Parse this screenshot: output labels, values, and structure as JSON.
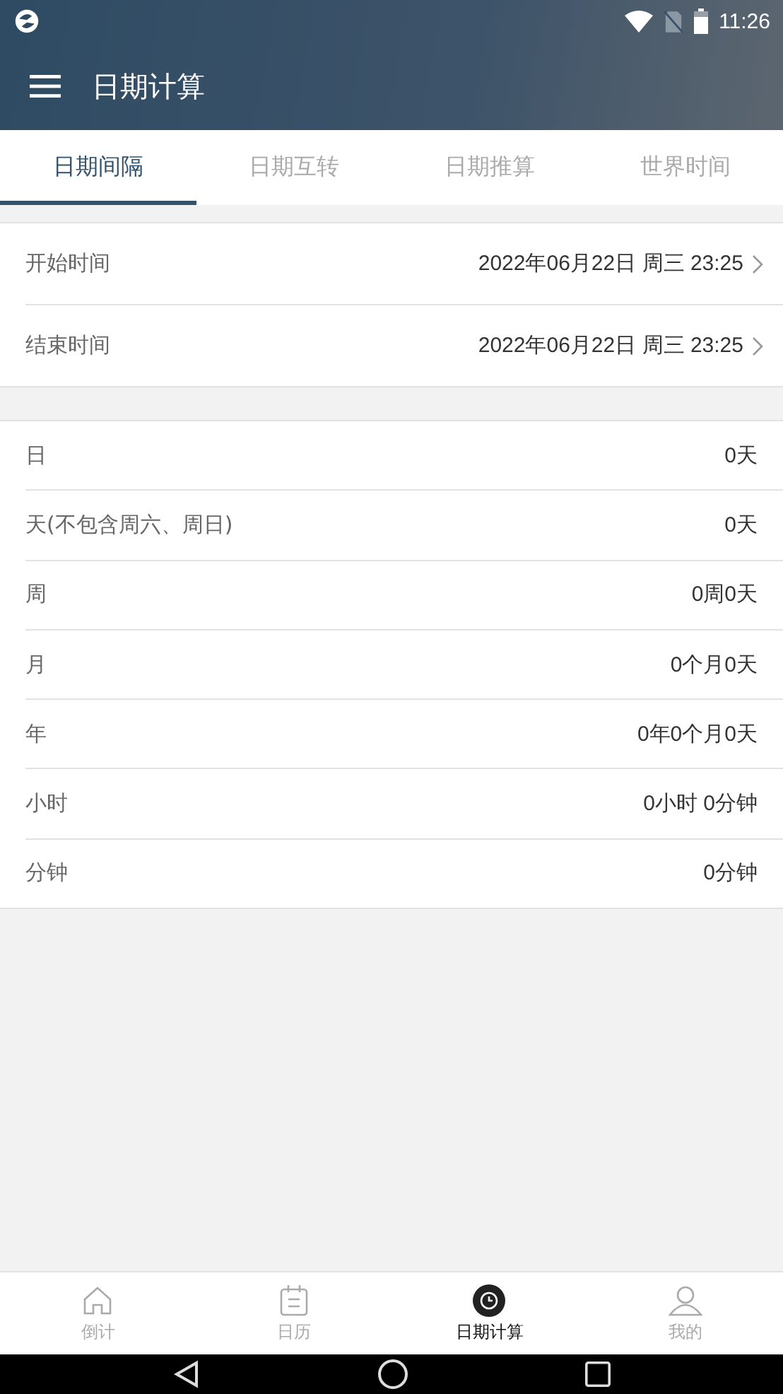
{
  "status_bar": {
    "time": "11:26"
  },
  "toolbar": {
    "title": "日期计算"
  },
  "tabs": [
    {
      "label": "日期间隔",
      "selected": true
    },
    {
      "label": "日期互转",
      "selected": false
    },
    {
      "label": "日期推算",
      "selected": false
    },
    {
      "label": "世界时间",
      "selected": false
    }
  ],
  "inputs": [
    {
      "label": "开始时间",
      "value": "2022年06月22日 周三 23:25"
    },
    {
      "label": "结束时间",
      "value": "2022年06月22日 周三 23:25"
    }
  ],
  "results": [
    {
      "label": "日",
      "value": "0天"
    },
    {
      "label": "天(不包含周六、周日)",
      "value": "0天"
    },
    {
      "label": "周",
      "value": "0周0天"
    },
    {
      "label": "月",
      "value": "0个月0天"
    },
    {
      "label": "年",
      "value": "0年0个月0天"
    },
    {
      "label": "小时",
      "value": "0小时 0分钟"
    },
    {
      "label": "分钟",
      "value": "0分钟"
    }
  ],
  "bottom_nav": [
    {
      "kind": "home",
      "label": "倒计",
      "selected": false
    },
    {
      "kind": "calendar",
      "label": "日历",
      "selected": false
    },
    {
      "kind": "clock",
      "label": "日期计算",
      "selected": true
    },
    {
      "kind": "person",
      "label": "我的",
      "selected": false
    }
  ]
}
